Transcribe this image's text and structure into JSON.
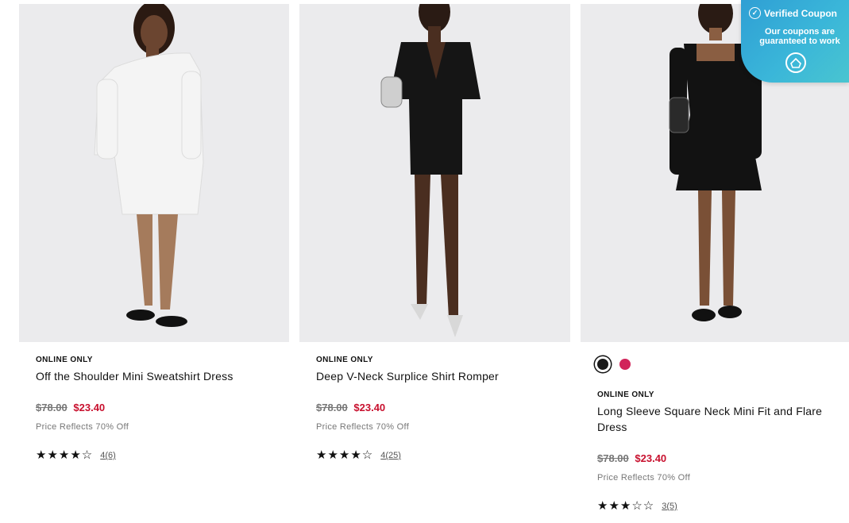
{
  "products": [
    {
      "badge": "ONLINE ONLY",
      "title": "Off the Shoulder Mini Sweatshirt Dress",
      "original_price": "$78.00",
      "sale_price": "$23.40",
      "price_note": "Price Reflects 70% Off",
      "stars": "★★★★☆",
      "rating": 4,
      "review_count": "4(6)",
      "dress_color": "#f4f4f4"
    },
    {
      "badge": "ONLINE ONLY",
      "title": "Deep V-Neck Surplice Shirt Romper",
      "original_price": "$78.00",
      "sale_price": "$23.40",
      "price_note": "Price Reflects 70% Off",
      "stars": "★★★★☆",
      "rating": 4,
      "review_count": "4(25)",
      "dress_color": "#151515"
    },
    {
      "badge": "ONLINE ONLY",
      "title": "Long Sleeve Square Neck Mini Fit and Flare Dress",
      "original_price": "$78.00",
      "sale_price": "$23.40",
      "price_note": "Price Reflects 70% Off",
      "stars": "★★★☆☆",
      "rating": 3,
      "review_count": "3(5)",
      "dress_color": "#121212",
      "swatches": [
        {
          "color": "#1a1a1a",
          "selected": true
        },
        {
          "color": "#d1245a",
          "selected": false
        }
      ]
    }
  ],
  "coupon": {
    "title": "Verified Coupon",
    "subtitle": "Our coupons are guaranteed to work"
  }
}
